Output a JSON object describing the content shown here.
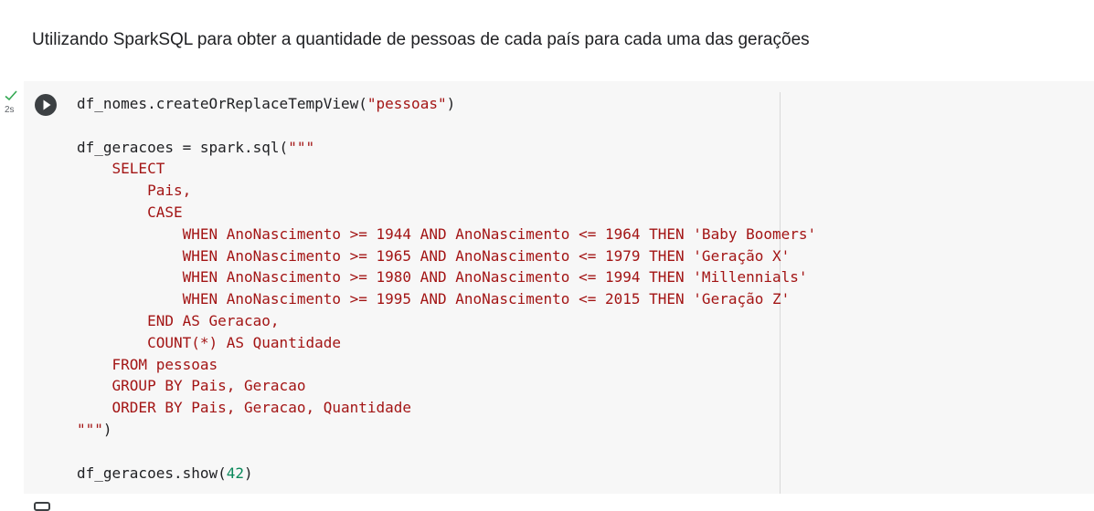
{
  "text_cell": {
    "heading": "Utilizando SparkSQL para obter a quantidade de pessoas de cada país para cada uma das gerações"
  },
  "code_cell": {
    "status_icon": "check-icon",
    "exec_time": "2s",
    "run_icon": "play-icon",
    "lines": [
      {
        "parts": [
          {
            "t": "df_nomes.createOrReplaceTempView(",
            "c": "plain"
          },
          {
            "t": "\"pessoas\"",
            "c": "str"
          },
          {
            "t": ")",
            "c": "plain"
          }
        ]
      },
      {
        "parts": []
      },
      {
        "parts": [
          {
            "t": "df_geracoes = spark.sql(",
            "c": "plain"
          },
          {
            "t": "\"\"\"",
            "c": "str"
          }
        ]
      },
      {
        "parts": [
          {
            "t": "    SELECT",
            "c": "sql"
          }
        ]
      },
      {
        "parts": [
          {
            "t": "        Pais,",
            "c": "sql"
          }
        ]
      },
      {
        "parts": [
          {
            "t": "        CASE",
            "c": "sql"
          }
        ]
      },
      {
        "parts": [
          {
            "t": "            WHEN AnoNascimento >= 1944 AND AnoNascimento <= 1964 THEN 'Baby Boomers'",
            "c": "sql"
          }
        ]
      },
      {
        "parts": [
          {
            "t": "            WHEN AnoNascimento >= 1965 AND AnoNascimento <= 1979 THEN 'Geração X'",
            "c": "sql"
          }
        ]
      },
      {
        "parts": [
          {
            "t": "            WHEN AnoNascimento >= 1980 AND AnoNascimento <= 1994 THEN 'Millennials'",
            "c": "sql"
          }
        ]
      },
      {
        "parts": [
          {
            "t": "            WHEN AnoNascimento >= 1995 AND AnoNascimento <= 2015 THEN 'Geração Z'",
            "c": "sql"
          }
        ]
      },
      {
        "parts": [
          {
            "t": "        END AS Geracao,",
            "c": "sql"
          }
        ]
      },
      {
        "parts": [
          {
            "t": "        COUNT(*) AS Quantidade",
            "c": "sql"
          }
        ]
      },
      {
        "parts": [
          {
            "t": "    FROM pessoas",
            "c": "sql"
          }
        ]
      },
      {
        "parts": [
          {
            "t": "    GROUP BY Pais, Geracao",
            "c": "sql"
          }
        ]
      },
      {
        "parts": [
          {
            "t": "    ORDER BY Pais, Geracao, Quantidade",
            "c": "sql"
          }
        ]
      },
      {
        "parts": [
          {
            "t": "\"\"\"",
            "c": "str"
          },
          {
            "t": ")",
            "c": "plain"
          }
        ]
      },
      {
        "parts": []
      },
      {
        "parts": [
          {
            "t": "df_geracoes.show(",
            "c": "plain"
          },
          {
            "t": "42",
            "c": "num"
          },
          {
            "t": ")",
            "c": "plain"
          }
        ]
      }
    ]
  },
  "colors": {
    "string": "#a31515",
    "number": "#09885a",
    "code_bg": "#f7f7f7",
    "check": "#34a853"
  }
}
